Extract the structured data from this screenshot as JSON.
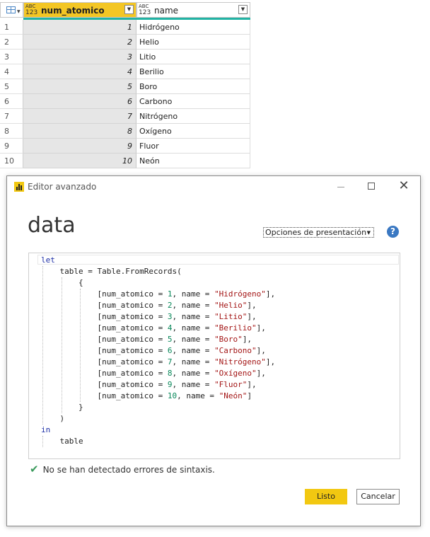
{
  "grid": {
    "columns": [
      {
        "type_top": "ABC",
        "type_bottom": "123",
        "name": "num_atomico"
      },
      {
        "type_top": "ABC",
        "type_bottom": "123",
        "name": "name"
      }
    ],
    "rows": [
      {
        "index": "1",
        "num": "1",
        "name": "Hidrógeno"
      },
      {
        "index": "2",
        "num": "2",
        "name": "Helio"
      },
      {
        "index": "3",
        "num": "3",
        "name": "Litio"
      },
      {
        "index": "4",
        "num": "4",
        "name": "Berilio"
      },
      {
        "index": "5",
        "num": "5",
        "name": "Boro"
      },
      {
        "index": "6",
        "num": "6",
        "name": "Carbono"
      },
      {
        "index": "7",
        "num": "7",
        "name": "Nitrógeno"
      },
      {
        "index": "8",
        "num": "8",
        "name": "Oxígeno"
      },
      {
        "index": "9",
        "num": "9",
        "name": "Fluor"
      },
      {
        "index": "10",
        "num": "10",
        "name": "Neón"
      }
    ]
  },
  "dialog": {
    "title": "Editor avanzado",
    "query_name": "data",
    "options_label": "Opciones de presentación",
    "help_icon": "?",
    "close_icon": "✕",
    "status_text": "No se han detectado errores de sintaxis.",
    "ok_label": "Listo",
    "cancel_label": "Cancelar",
    "accent_color": "#f2c811"
  },
  "code": {
    "let": "let",
    "table_decl": "table = Table.FromRecords(",
    "open_brace": "{",
    "records": [
      {
        "num": "1",
        "name": "\"Hidrógeno\"",
        "sep": "],"
      },
      {
        "num": "2",
        "name": "\"Helio\"",
        "sep": "],"
      },
      {
        "num": "3",
        "name": "\"Litio\"",
        "sep": "],"
      },
      {
        "num": "4",
        "name": "\"Berilio\"",
        "sep": "],"
      },
      {
        "num": "5",
        "name": "\"Boro\"",
        "sep": "],"
      },
      {
        "num": "6",
        "name": "\"Carbono\"",
        "sep": "],"
      },
      {
        "num": "7",
        "name": "\"Nitrógeno\"",
        "sep": "],"
      },
      {
        "num": "8",
        "name": "\"Oxígeno\"",
        "sep": "],"
      },
      {
        "num": "9",
        "name": "\"Fluor\"",
        "sep": "],"
      },
      {
        "num": "10",
        "name": "\"Neón\"",
        "sep": "]"
      }
    ],
    "record_prefix": "[num_atomico = ",
    "record_mid": ", name = ",
    "close_brace": "}",
    "close_paren": ")",
    "in": "in",
    "result": "table"
  }
}
